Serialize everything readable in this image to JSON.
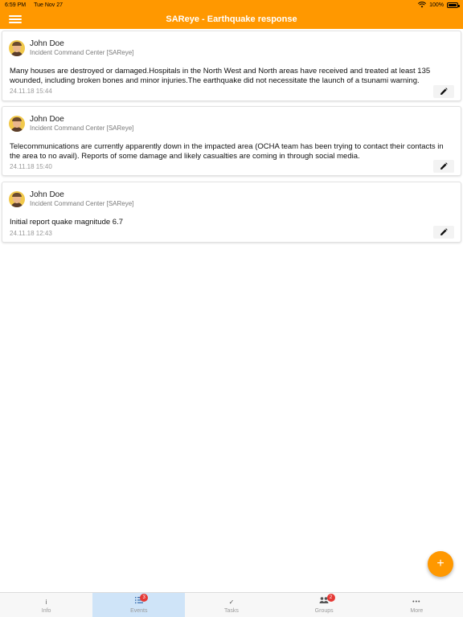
{
  "status_bar": {
    "time": "6:59 PM",
    "date": "Tue Nov 27",
    "battery": "100%"
  },
  "app_bar": {
    "title": "SAReye - Earthquake response"
  },
  "posts": [
    {
      "author": "John Doe",
      "organization": "Incident Command Center [SAReye]",
      "message": "Many houses are destroyed or damaged.Hospitals in the North West and North areas have received and treated at least 135 wounded, including broken bones and minor injuries.The earthquake did not necessitate the launch of a tsunami warning.",
      "timestamp": "24.11.18 15:44"
    },
    {
      "author": "John Doe",
      "organization": "Incident Command Center [SAReye]",
      "message": "Telecommunications are currently apparently down in the impacted area (OCHA team has been trying to contact their contacts in the area to no avail). Reports of some damage and likely casualties are coming in through social media.",
      "timestamp": "24.11.18 15:40"
    },
    {
      "author": "John Doe",
      "organization": "Incident Command Center [SAReye]",
      "message": "Initial report quake magnitude 6.7",
      "timestamp": "24.11.18 12:43"
    }
  ],
  "fab": {
    "icon": "+"
  },
  "tabs": [
    {
      "label": "Info",
      "icon": "i"
    },
    {
      "label": "Events",
      "badge": "3"
    },
    {
      "label": "Tasks",
      "icon": "✓"
    },
    {
      "label": "Groups",
      "badge": "2"
    },
    {
      "label": "More",
      "icon": "•••"
    }
  ],
  "colors": {
    "accent": "#ff9800",
    "active_tab": "#cfe4f8",
    "badge": "#e53935"
  }
}
